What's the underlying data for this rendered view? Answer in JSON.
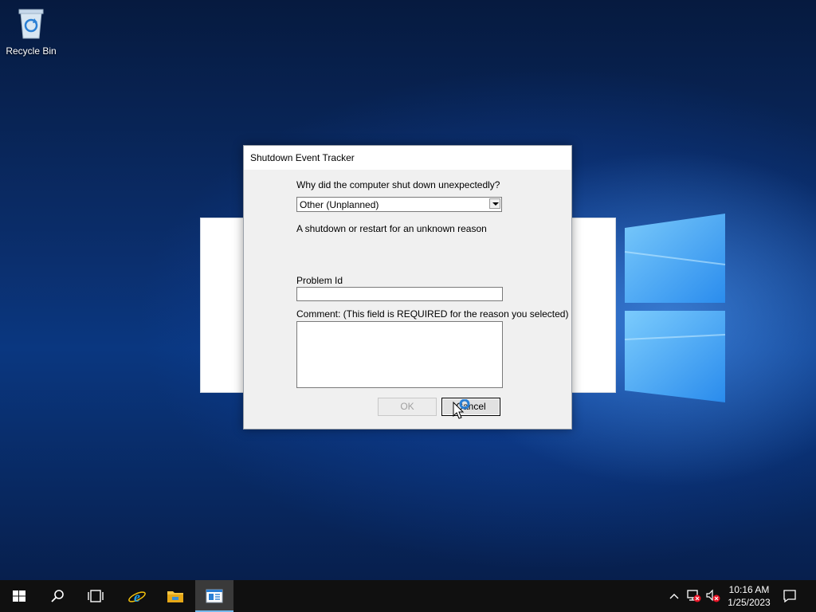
{
  "desktop": {
    "icons": [
      {
        "label": "Recycle Bin",
        "icon": "recycle-bin-icon"
      }
    ]
  },
  "dialog": {
    "title": "Shutdown Event Tracker",
    "question": "Why did the computer shut down unexpectedly?",
    "reason_selected": "Other (Unplanned)",
    "reason_description": "A shutdown or restart for an unknown reason",
    "problem_id_label": "Problem Id",
    "problem_id_value": "",
    "comment_label": "Comment: (This field is REQUIRED for the reason you selected)",
    "comment_value": "",
    "ok_label": "OK",
    "cancel_label": "Cancel"
  },
  "taskbar": {
    "items": [
      "start-icon",
      "search-icon",
      "task-view-icon",
      "internet-explorer-icon",
      "file-explorer-icon",
      "shutdown-tracker-app-icon"
    ],
    "tray": {
      "time": "10:16 AM",
      "date": "1/25/2023",
      "icons": [
        "chevron-up-icon",
        "network-error-icon",
        "volume-muted-icon",
        "action-center-icon"
      ]
    }
  },
  "colors": {
    "taskbar_bg": "#101010",
    "dialog_bg": "#f0f0f0",
    "accent": "#76b9ed"
  }
}
